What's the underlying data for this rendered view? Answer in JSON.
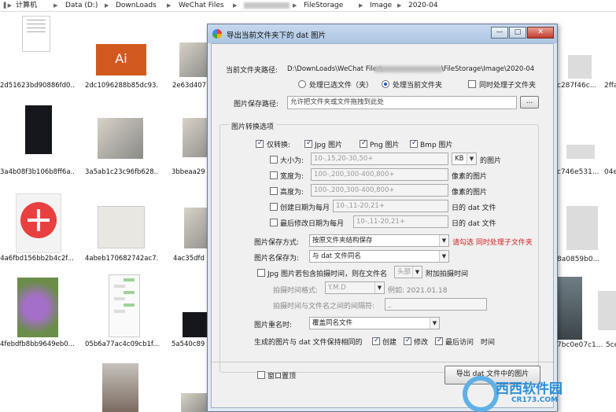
{
  "breadcrumb": {
    "parts": [
      "计算机",
      "Data (D:)",
      "DownLoads",
      "WeChat Files",
      "FileStorage",
      "Image",
      "2020-04"
    ]
  },
  "files": [
    {
      "name": "2d51623bd90886fd0...",
      "thumb": "document"
    },
    {
      "name": "2dc1096288b85dc93...",
      "thumb": "ai-logo"
    },
    {
      "name": "2e63d407",
      "thumb": "photo"
    },
    {
      "name": "3a4b08f3b106b8ff6a...",
      "thumb": "dark"
    },
    {
      "name": "3a5ab1c23c96fb628...",
      "thumb": "photo"
    },
    {
      "name": "3bbeaa29",
      "thumb": "photo"
    },
    {
      "name": "4a6fbd156bb2b4c2f...",
      "thumb": "plus"
    },
    {
      "name": "4abeb170682742ac7...",
      "thumb": "card"
    },
    {
      "name": "4ac35dfd",
      "thumb": "photo"
    },
    {
      "name": "4febdfb8bb9649eb0...",
      "thumb": "flower"
    },
    {
      "name": "05b6a77ac4c09cb1f...",
      "thumb": "chat"
    },
    {
      "name": "5a540c89",
      "thumb": "photo"
    },
    {
      "name": "c287f46c...",
      "thumb": "gray"
    },
    {
      "name": "2ffa",
      "thumb": "gray"
    },
    {
      "name": "c746e531...",
      "thumb": "gray"
    },
    {
      "name": "04e",
      "thumb": "gray"
    },
    {
      "name": "8a0859b0...",
      "thumb": "gray"
    },
    {
      "name": "7bc0e07c1...",
      "thumb": "street"
    },
    {
      "name": "5ce",
      "thumb": "gray"
    }
  ],
  "dialog": {
    "title": "导出当前文件夹下的 dat 图片",
    "window_buttons": {
      "minimize": "—",
      "maximize": "□",
      "close": "✕"
    },
    "current_path_label": "当前文件夹路径:",
    "current_path_prefix": "D:\\DownLoads\\WeChat Files\\",
    "current_path_suffix": "\\FileStorage\\Image\\2020-04",
    "radio_selected_files": "处理已选文件（夹）",
    "radio_current_folder": "处理当前文件夹",
    "check_subfolders": "同时处理子文件夹",
    "save_path_label": "图片保存路径:",
    "save_path_placeholder": "允许把文件夹或文件拖拽到此处",
    "browse_button": "...",
    "group_title": "图片转换选项",
    "only_convert_label": "仅转换:",
    "format_jpg": "Jpg 图片",
    "format_png": "Png 图片",
    "format_bmp": "Bmp 图片",
    "size_label": "大小为:",
    "size_value": "10-,15,20-30,50+",
    "size_unit": "KB",
    "size_suffix": "的图片",
    "width_label": "宽度为:",
    "width_value": "100-,200,300-400,800+",
    "width_suffix": "像素的图片",
    "height_label": "高度为:",
    "height_value": "100-,200,300-400,800+",
    "height_suffix": "像素的图片",
    "created_label": "创建日期为每月",
    "created_value": "10-,11-20,21+",
    "created_suffix": "日的 dat 文件",
    "modified_label": "最后修改日期为每月",
    "modified_value": "10-,11-20,21+",
    "modified_suffix": "日的 dat 文件",
    "save_mode_label": "图片保存方式:",
    "save_mode_value": "按原文件夹结构保存",
    "save_mode_note": "请勾选 同时处理子文件夹",
    "save_name_label": "图片名保存为:",
    "save_name_value": "与 dat 文件同名",
    "jpg_time_label": "Jpg 图片若包含拍摄时间，则在文件名",
    "jpg_time_position": "头部",
    "jpg_time_suffix": "附加拍摄时间",
    "time_format_label": "拍摄时间格式:",
    "time_format_value": "Y.M.D",
    "time_format_example": "例如: 2021.01.18",
    "separator_label": "拍摄时间与文件名之间的间隔符:",
    "separator_value": "_",
    "rename_label": "图片重名时:",
    "rename_value": "覆盖同名文件",
    "keep_times_label": "生成的图片与 dat 文件保持相同的",
    "keep_created": "创建",
    "keep_modified": "修改",
    "keep_accessed": "最后访问",
    "keep_time_suffix": "时间",
    "topmost_label": "窗口置顶",
    "export_button": "导出 dat 文件中的图片"
  },
  "watermark": {
    "brand": "西西软件园",
    "site": "CR173.COM"
  }
}
